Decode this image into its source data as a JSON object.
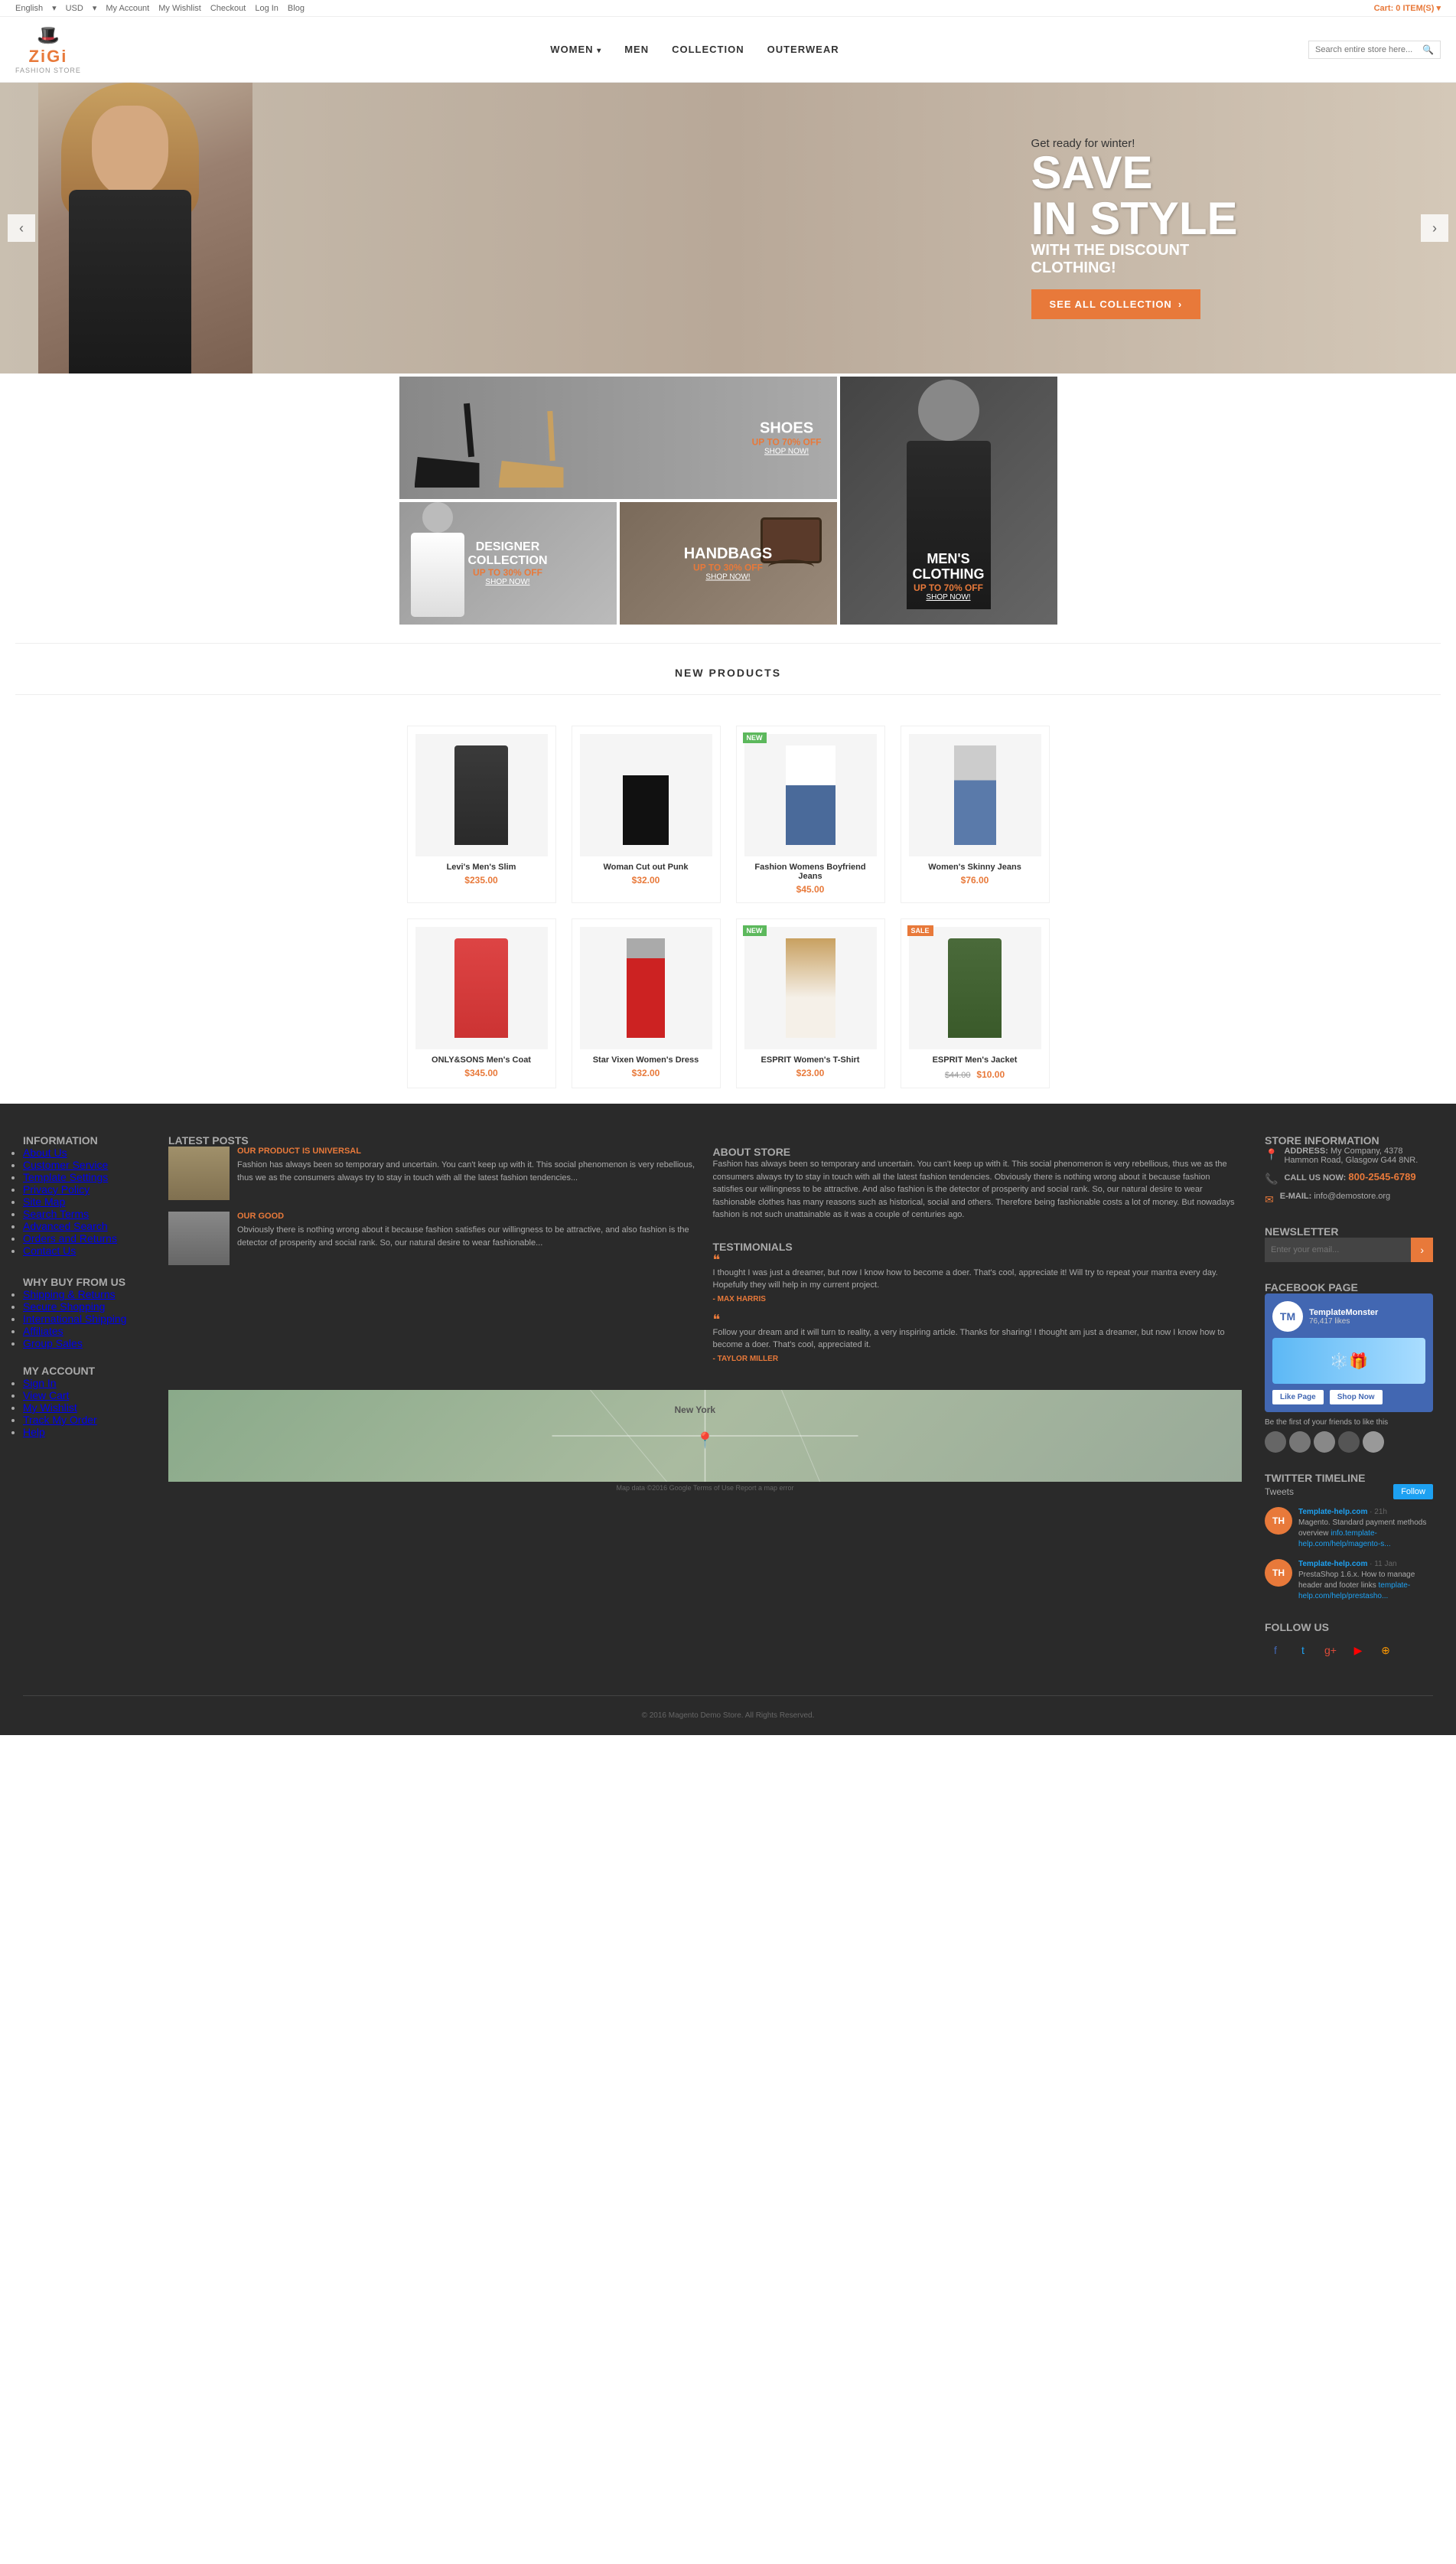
{
  "topbar": {
    "language": "English",
    "currency": "USD",
    "links": [
      "My Account",
      "My Wishlist",
      "Checkout",
      "Log In",
      "Blog"
    ],
    "cart_label": "Cart:",
    "cart_count": "0 ITEM(S)"
  },
  "header": {
    "logo_icon": "🎩",
    "logo_text": "ZiGi",
    "logo_tagline": "FASHION STORE"
  },
  "nav": {
    "items": [
      {
        "label": "WOMEN",
        "has_dropdown": true
      },
      {
        "label": "MEN",
        "has_dropdown": false
      },
      {
        "label": "COLLECTION",
        "has_dropdown": false
      },
      {
        "label": "OUTERWEAR",
        "has_dropdown": false
      }
    ],
    "search_placeholder": "Search entire store here..."
  },
  "hero": {
    "pre_text": "Get ready for winter!",
    "title_line1": "SAVE",
    "title_line2": "IN STYLE",
    "subtitle": "WITH THE DISCOUNT",
    "subtitle2": "CLOTHING!",
    "cta_label": "SEE ALL COLLECTION",
    "arrow_left": "‹",
    "arrow_right": "›"
  },
  "promo": {
    "shoes": {
      "title": "SHOES",
      "discount": "UP TO 70% OFF",
      "shop": "SHOP NOW!"
    },
    "designer": {
      "title": "DESIGNER COLLECTION",
      "discount": "UP TO 30% OFF",
      "shop": "SHOP NOW!"
    },
    "handbags": {
      "title": "HANDBAGS",
      "discount": "UP TO 30% OFF",
      "shop": "SHOP NOW!"
    },
    "mens": {
      "title": "MEN'S CLOTHING",
      "discount": "UP TO 70% OFF",
      "shop": "SHOP NOW!"
    }
  },
  "new_products": {
    "section_title": "NEW PRODUCTS",
    "items": [
      {
        "name": "Levi's Men's Slim",
        "price": "$235.00",
        "old_price": null,
        "badge": null
      },
      {
        "name": "Woman Cut out Punk",
        "price": "$32.00",
        "old_price": null,
        "badge": null
      },
      {
        "name": "Fashion Womens Boyfriend Jeans",
        "price": "$45.00",
        "old_price": null,
        "badge": "New"
      },
      {
        "name": "Women's Skinny Jeans",
        "price": "$76.00",
        "old_price": null,
        "badge": null
      },
      {
        "name": "ONLY&SONS Men's Coat",
        "price": "$345.00",
        "old_price": null,
        "badge": null
      },
      {
        "name": "Star Vixen Women's Dress",
        "price": "$32.00",
        "old_price": null,
        "badge": null
      },
      {
        "name": "ESPRIT Women's T-Shirt",
        "price": "$23.00",
        "old_price": null,
        "badge": "New"
      },
      {
        "name": "ESPRIT Men's Jacket",
        "price": "$10.00",
        "old_price": "$44.00",
        "badge": "Sale"
      }
    ]
  },
  "footer": {
    "information": {
      "title": "INFORMATION",
      "links": [
        "About Us",
        "Customer Service",
        "Template Settings",
        "Privacy Policy",
        "Site Map",
        "Search Terms",
        "Advanced Search",
        "Orders and Returns",
        "Contact Us"
      ]
    },
    "why_buy": {
      "title": "WHY BUY FROM US",
      "links": [
        "Shipping & Returns",
        "Secure Shopping",
        "International Shipping",
        "Affiliates",
        "Group Sales"
      ]
    },
    "my_account": {
      "title": "MY ACCOUNT",
      "links": [
        "Sign In",
        "View Cart",
        "My Wishlist",
        "Track My Order",
        "Help"
      ]
    },
    "latest_posts": {
      "title": "LATEST POSTS",
      "post1": {
        "tag": "OUR PRODUCT IS UNIVERSAL",
        "text": "Fashion has always been so temporary and uncertain. You can't keep up with it. This social phenomenon is very rebellious, thus we as the consumers always try to stay in touch with all the latest fashion tendencies..."
      },
      "post2": {
        "tag": "OUR GOOD",
        "text": "Obviously there is nothing wrong about it because fashion satisfies our willingness to be attractive, and also fashion is the detector of prosperity and social rank. So, our natural desire to wear fashionable..."
      }
    },
    "about_store": {
      "title": "ABOUT STORE",
      "text": "Fashion has always been so temporary and uncertain. You can't keep up with it. This social phenomenon is very rebellious, thus we as the consumers always try to stay in touch with all the latest fashion tendencies. Obviously there is nothing wrong about it because fashion satisfies our willingness to be attractive. And also fashion is the detector of prosperity and social rank. So, our natural desire to wear fashionable clothes has many reasons such as historical, social and others. Therefore being fashionable costs a lot of money. But nowadays fashion is not such unattainable as it was a couple of centuries ago."
    },
    "testimonials": {
      "title": "TESTIMONIALS",
      "items": [
        {
          "text": "I thought I was just a dreamer, but now I know how to become a doer. That's cool, appreciate it! Will try to repeat your mantra every day. Hopefully they will help in my current project.",
          "author": "- MAX HARRIS"
        },
        {
          "text": "Follow your dream and it will turn to reality, a very inspiring article. Thanks for sharing! I thought am just a dreamer, but now I know how to become a doer. That's cool, appreciated it.",
          "author": "- TAYLOR MILLER"
        }
      ]
    },
    "store_info": {
      "title": "STORE INFORMATION",
      "address": "My Company, 4378 Hammon Road, Glasgow G44 8NR.",
      "phone": "800-2545-6789",
      "email": "info@demostore.org",
      "address_icon": "📍",
      "phone_icon": "📞",
      "email_icon": "✉"
    },
    "newsletter": {
      "title": "NEWSLETTER",
      "placeholder": "Enter your email...",
      "btn": "›"
    },
    "facebook": {
      "title": "FACEBOOK PAGE",
      "name": "TemplateMonster",
      "likes": "76,417 likes",
      "like_btn": "Like Page",
      "shop_btn": "Shop Now"
    },
    "twitter": {
      "title": "TWITTER TIMELINE",
      "tweets_label": "Tweets",
      "follow_label": "Follow",
      "tweet1": {
        "author": "Template-help.com @templatehelp.com",
        "time": "21h",
        "text": "Magento. Standard payment methods overview info.template-help.com/help/magento-s..."
      },
      "tweet2": {
        "author": "Template-help.com @templatehelp.com",
        "time": "11 Jan",
        "text": "PrestaShop 1.6.x. How to manage header and footer links template-help.com/help/prestasho..."
      }
    },
    "follow_us": {
      "title": "FOLLOW US",
      "facebook": "f",
      "twitter": "t",
      "googleplus": "g+",
      "youtube": "▶",
      "rss": "⊕"
    },
    "copyright": "© 2016 Magento Demo Store. All Rights Reserved."
  }
}
